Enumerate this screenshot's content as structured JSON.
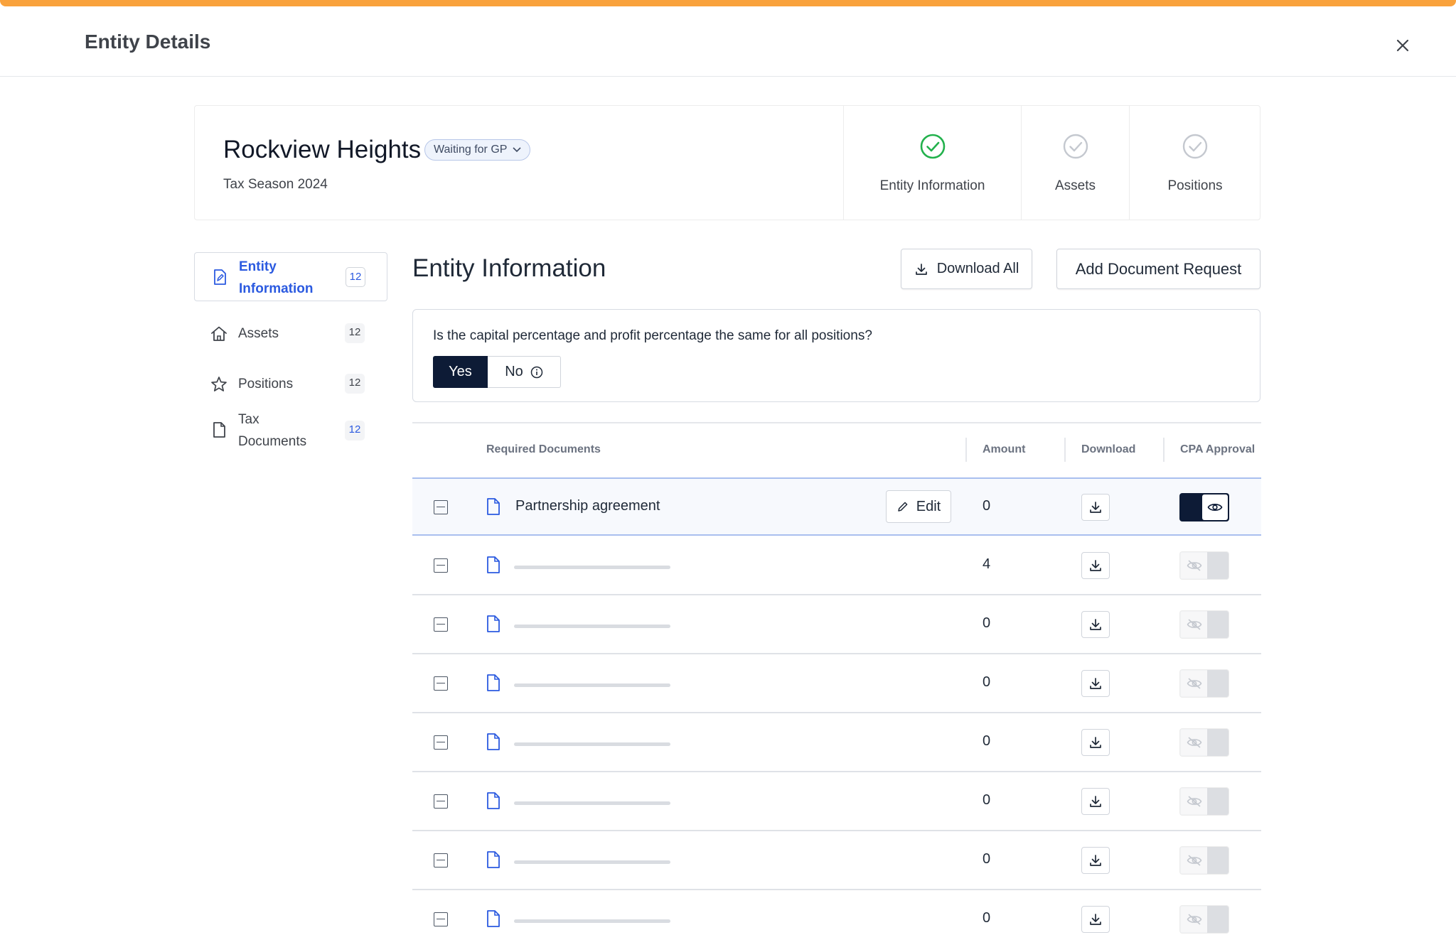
{
  "header": {
    "title": "Entity Details"
  },
  "entity": {
    "name": "Rockview Heights",
    "status": "Waiting for GP",
    "tax_season": "Tax Season 2024"
  },
  "steps": [
    {
      "label": "Entity Information",
      "complete": true
    },
    {
      "label": "Assets",
      "complete": false
    },
    {
      "label": "Positions",
      "complete": false
    }
  ],
  "sidebar": {
    "items": [
      {
        "label_line1": "Entity",
        "label_line2": "Information",
        "count": "12",
        "active": true,
        "icon": "document-edit-icon"
      },
      {
        "label_line1": "Assets",
        "count": "12",
        "icon": "home-icon"
      },
      {
        "label_line1": "Positions",
        "count": "12",
        "icon": "star-icon"
      },
      {
        "label_line1": "Tax",
        "label_line2": "Documents",
        "count": "12",
        "icon": "file-icon"
      }
    ]
  },
  "main": {
    "title": "Entity Information",
    "download_all_label": "Download All",
    "add_request_label": "Add Document Request",
    "question": {
      "text": "Is the capital percentage and profit percentage the same for all positions?",
      "yes_label": "Yes",
      "no_label": "No",
      "selected": "Yes"
    }
  },
  "table": {
    "columns": {
      "documents": "Required Documents",
      "amount": "Amount",
      "download": "Download",
      "approval": "CPA Approval"
    },
    "edit_label": "Edit",
    "rows": [
      {
        "name": "Partnership agreement",
        "amount": "0",
        "approved": true,
        "selected": true
      },
      {
        "name": "",
        "amount": "4",
        "approved": false
      },
      {
        "name": "",
        "amount": "0",
        "approved": false
      },
      {
        "name": "",
        "amount": "0",
        "approved": false
      },
      {
        "name": "",
        "amount": "0",
        "approved": false
      },
      {
        "name": "",
        "amount": "0",
        "approved": false
      },
      {
        "name": "",
        "amount": "0",
        "approved": false
      },
      {
        "name": "",
        "amount": "0",
        "approved": false
      }
    ]
  },
  "colors": {
    "accent": "#f9a23c",
    "primary_dark": "#0d1b36",
    "link_blue": "#2b5ae0",
    "success_green": "#22b14c"
  }
}
